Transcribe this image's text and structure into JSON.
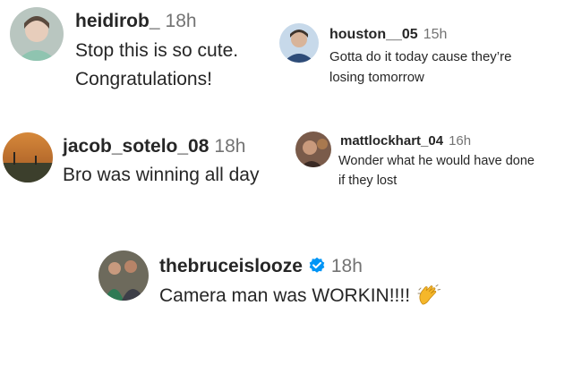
{
  "comments": [
    {
      "username": "heidirob_",
      "time": "18h",
      "lines": [
        "Stop this is so cute.",
        "Congratulations!"
      ]
    },
    {
      "username": "houston__05",
      "time": "15h",
      "lines": [
        "Gotta do it today cause they’re",
        "losing tomorrow"
      ]
    },
    {
      "username": "jacob_sotelo_08",
      "time": "18h",
      "lines": [
        "Bro was winning all day"
      ]
    },
    {
      "username": "mattlockhart_04",
      "time": "16h",
      "lines": [
        "Wonder what he would have done",
        "if they lost"
      ]
    },
    {
      "username": "thebruceislooze",
      "time": "18h",
      "verified": true,
      "lines": [
        "Camera man was WORKIN!!!!"
      ],
      "emoji": "clapping-hands"
    }
  ],
  "colors": {
    "text": "#262626",
    "meta": "#737373",
    "verified": "#0095F6",
    "clap": "#F5B72A"
  }
}
